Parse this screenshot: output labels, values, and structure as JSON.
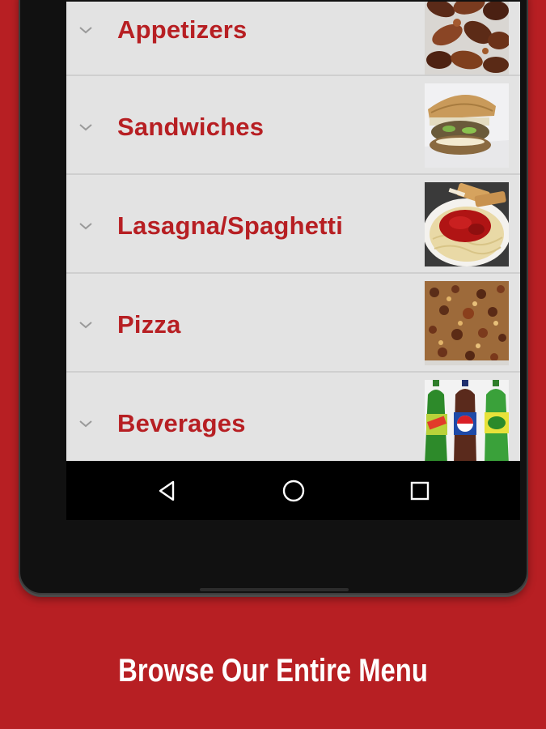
{
  "menu": {
    "items": [
      {
        "label": "Appetizers",
        "icon": "chevron-down-icon",
        "image": "chicken-wings-photo"
      },
      {
        "label": "Sandwiches",
        "icon": "chevron-down-icon",
        "image": "sandwich-photo"
      },
      {
        "label": "Lasagna/Spaghetti",
        "icon": "chevron-down-icon",
        "image": "spaghetti-photo"
      },
      {
        "label": "Pizza",
        "icon": "chevron-down-icon",
        "image": "pizza-photo"
      },
      {
        "label": "Beverages",
        "icon": "chevron-down-icon",
        "image": "soda-bottles-photo"
      }
    ]
  },
  "navbar": {
    "back_icon": "back-triangle-icon",
    "home_icon": "home-circle-icon",
    "recents_icon": "recents-square-icon"
  },
  "tagline": "Browse Our Entire Menu",
  "colors": {
    "brand_red": "#b71f23",
    "list_background": "#e3e3e3",
    "text_white": "#ffffff"
  }
}
